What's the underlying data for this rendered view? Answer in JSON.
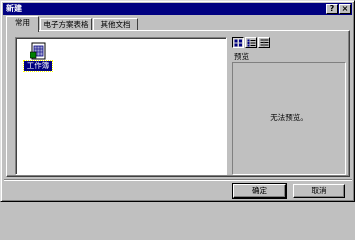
{
  "window": {
    "title": "新建",
    "help_label": "?",
    "close_label": "×"
  },
  "tabs": [
    {
      "label": "常用",
      "active": true
    },
    {
      "label": "电子方案表格",
      "active": false
    },
    {
      "label": "其他文档",
      "active": false
    }
  ],
  "files": [
    {
      "label": "工作簿",
      "icon": "workbook-icon",
      "selected": true
    }
  ],
  "view_buttons": [
    {
      "icon": "large-icons-view-icon",
      "pressed": true
    },
    {
      "icon": "list-view-icon",
      "pressed": false
    },
    {
      "icon": "details-view-icon",
      "pressed": false
    }
  ],
  "preview": {
    "label": "预览",
    "message": "无法预览。"
  },
  "buttons": {
    "ok": "确定",
    "cancel": "取消"
  },
  "colors": {
    "titlebar": "#000080",
    "face": "#c0c0c0",
    "selection": "#000080"
  }
}
